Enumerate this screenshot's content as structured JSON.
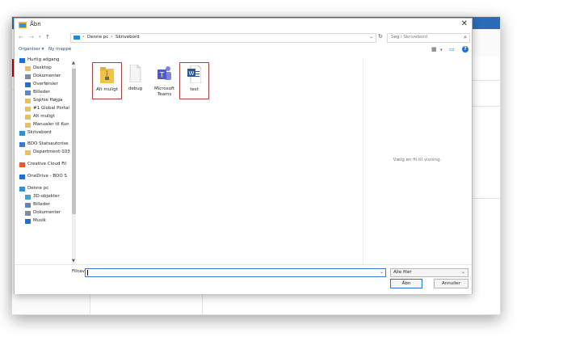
{
  "window": {
    "title": "Åbn",
    "close_icon": "close-icon"
  },
  "address": {
    "crumbs": [
      "Denne pc",
      "Skrivebord"
    ],
    "search_placeholder": "Søg i Skrivebord"
  },
  "toolbar": {
    "organize": "Organiser ▾",
    "new_folder": "Ny mappe"
  },
  "nav_items": [
    {
      "label": "Hurtig adgang",
      "icon": "star-icon",
      "pinned": false
    },
    {
      "label": "Desktop",
      "icon": "folder-icon",
      "pinned": true
    },
    {
      "label": "Dokumenter",
      "icon": "documents-icon",
      "pinned": true
    },
    {
      "label": "Overførsler",
      "icon": "download-icon",
      "pinned": true
    },
    {
      "label": "Billeder",
      "icon": "pictures-icon",
      "pinned": true
    },
    {
      "label": "Sophie Højga",
      "icon": "folder-icon",
      "pinned": true
    },
    {
      "label": "#1 Global Portal",
      "icon": "folder-icon",
      "pinned": false
    },
    {
      "label": "Alt muligt",
      "icon": "folder-icon",
      "pinned": false
    },
    {
      "label": "Manualer til Kun",
      "icon": "folder-icon",
      "pinned": false
    },
    {
      "label": "Skrivebord",
      "icon": "desktop-icon",
      "pinned": false
    },
    {
      "label": "BDO Statsautorise",
      "icon": "building-icon",
      "pinned": false
    },
    {
      "label": "Department-103",
      "icon": "folder-icon",
      "pinned": false
    },
    {
      "label": "Creative Cloud Fil",
      "icon": "creative-cloud-icon",
      "pinned": false
    },
    {
      "label": "OneDrive - BDO S",
      "icon": "onedrive-icon",
      "pinned": false
    },
    {
      "label": "Denne pc",
      "icon": "computer-icon",
      "pinned": false
    },
    {
      "label": "3D-objekter",
      "icon": "cube-icon",
      "pinned": false
    },
    {
      "label": "Billeder",
      "icon": "pictures-icon",
      "pinned": false
    },
    {
      "label": "Dokumenter",
      "icon": "documents-icon",
      "pinned": false
    },
    {
      "label": "Musik",
      "icon": "music-icon",
      "pinned": false
    }
  ],
  "files": [
    {
      "label": "Alt muligt",
      "icon": "folder-zip-icon",
      "selected": true
    },
    {
      "label": "debug",
      "icon": "file-icon",
      "selected": false
    },
    {
      "label": "Microsoft Teams",
      "icon": "teams-icon",
      "selected": false
    },
    {
      "label": "test",
      "icon": "word-doc-icon",
      "selected": true
    }
  ],
  "preview": {
    "text": "Vælg en fil til visning."
  },
  "footer": {
    "filename_label": "Filnavn:",
    "filename_value": "",
    "filter_value": "Alle filer",
    "open_label": "Åbn",
    "cancel_label": "Annuller"
  },
  "colors": {
    "accent": "#2a6fd6",
    "selection_border": "#b04040",
    "title_blue": "#2b6cb8"
  }
}
